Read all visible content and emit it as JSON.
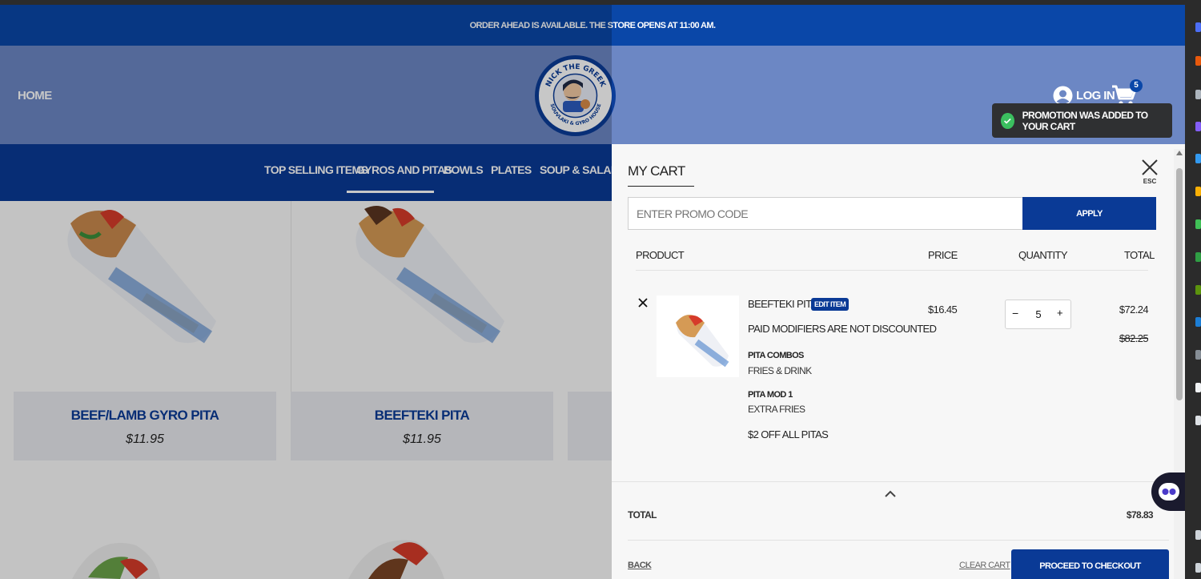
{
  "announcement": "ORDER AHEAD IS AVAILABLE. THE STORE OPENS AT 11:00 AM.",
  "header": {
    "home": "HOME",
    "logo_top": "NICK THE GREEK",
    "logo_bottom": "SOUVLAKI & GYRO HOUSE",
    "login": "LOG IN",
    "cart_count": "5"
  },
  "categories": [
    "TOP SELLING ITEMS",
    "GYROS AND PITAS",
    "BOWLS",
    "PLATES",
    "SOUP & SALADS"
  ],
  "active_category": "GYROS AND PITAS",
  "products": [
    {
      "name": "BEEF/LAMB GYRO PITA",
      "price": "$11.95"
    },
    {
      "name": "BEEFTEKI PITA",
      "price": "$11.95"
    }
  ],
  "toast": "PROMOTION WAS ADDED TO YOUR CART",
  "cart": {
    "title": "MY CART",
    "close_hint": "ESC",
    "promo_placeholder": "ENTER PROMO CODE",
    "apply": "APPLY",
    "columns": {
      "product": "PRODUCT",
      "price": "PRICE",
      "quantity": "QUANTITY",
      "total": "TOTAL"
    },
    "item": {
      "name": "BEEFTEKI PITA",
      "edit": "EDIT ITEM",
      "note": "PAID MODIFIERS ARE NOT DISCOUNTED",
      "modifiers": [
        {
          "group": "PITA COMBOS",
          "value": "FRIES & DRINK"
        },
        {
          "group": "PITA MOD 1",
          "value": "EXTRA FRIES"
        }
      ],
      "discount": "$2 OFF ALL PITAS",
      "price": "$16.45",
      "quantity": "5",
      "total": "$72.24",
      "original_total": "$82.25"
    },
    "total_label": "TOTAL",
    "total_value": "$78.83",
    "back": "BACK",
    "clear": "CLEAR CART",
    "checkout": "PROCEED TO CHECKOUT"
  },
  "colors": {
    "brand_blue": "#0a3a96",
    "header_blue": "#6c87c4",
    "toast_bg": "#2f3032",
    "success_green": "#3bbf5f"
  }
}
